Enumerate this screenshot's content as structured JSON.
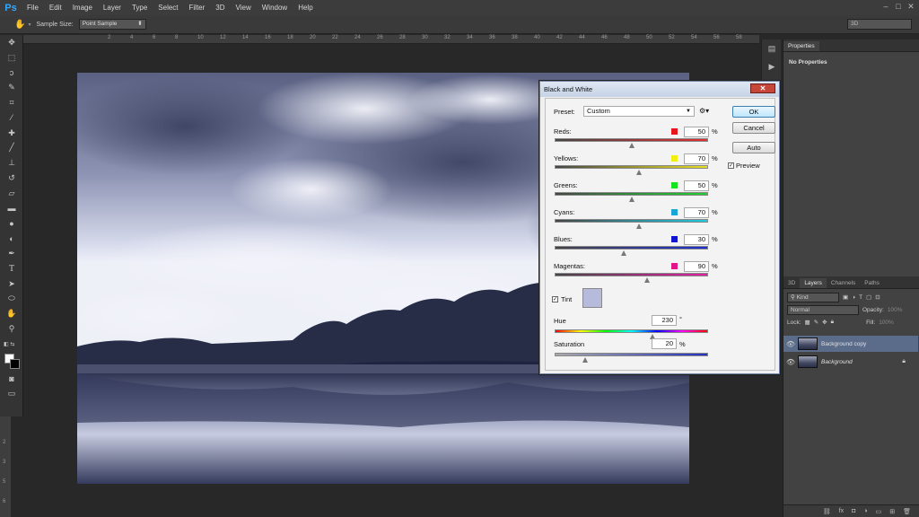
{
  "app": {
    "logo": "Ps",
    "menu": [
      "File",
      "Edit",
      "Image",
      "Layer",
      "Type",
      "Select",
      "Filter",
      "3D",
      "View",
      "Window",
      "Help"
    ]
  },
  "options_bar": {
    "sample_size_label": "Sample Size:",
    "sample_size_value": "Point Sample",
    "workspace": "3D"
  },
  "ruler": {
    "h_ticks": [
      "2",
      "4",
      "6",
      "8",
      "10",
      "12",
      "14",
      "16",
      "18",
      "20",
      "22",
      "24",
      "26",
      "28",
      "30",
      "32",
      "34",
      "36",
      "38",
      "40",
      "42",
      "44",
      "46",
      "48",
      "50",
      "52",
      "54",
      "56",
      "58"
    ],
    "v_ticks": [
      "2",
      "3",
      "5",
      "6"
    ]
  },
  "properties_panel": {
    "tab": "Properties",
    "message": "No Properties"
  },
  "layers_panel": {
    "tabs": [
      "3D",
      "Layers",
      "Channels",
      "Paths"
    ],
    "active_tab": "Layers",
    "filter": "Kind",
    "blend_mode": "Normal",
    "opacity_label": "Opacity:",
    "opacity_value": "100%",
    "lock_label": "Lock:",
    "fill_label": "Fill:",
    "fill_value": "100%",
    "layers": [
      {
        "name": "Background copy",
        "selected": true
      },
      {
        "name": "Background",
        "selected": false,
        "locked": true
      }
    ]
  },
  "dialog": {
    "title": "Black and White",
    "preset_label": "Preset:",
    "preset_value": "Custom",
    "buttons": {
      "ok": "OK",
      "cancel": "Cancel",
      "auto": "Auto"
    },
    "preview_label": "Preview",
    "preview_checked": true,
    "channels": [
      {
        "label": "Reds:",
        "value": "50",
        "unit": "%",
        "color": "#e8161c",
        "fraction": 0.5
      },
      {
        "label": "Yellows:",
        "value": "70",
        "unit": "%",
        "color": "#f1f011",
        "fraction": 0.55
      },
      {
        "label": "Greens:",
        "value": "50",
        "unit": "%",
        "color": "#13e41b",
        "fraction": 0.5
      },
      {
        "label": "Cyans:",
        "value": "70",
        "unit": "%",
        "color": "#18a6d7",
        "fraction": 0.55
      },
      {
        "label": "Blues:",
        "value": "30",
        "unit": "%",
        "color": "#1413d1",
        "fraction": 0.45
      },
      {
        "label": "Magentas:",
        "value": "90",
        "unit": "%",
        "color": "#e2168a",
        "fraction": 0.6
      }
    ],
    "tint_label": "Tint",
    "tint_checked": true,
    "tint_color": "#b6bbdb",
    "hue_label": "Hue",
    "hue_value": "230",
    "hue_unit": "°",
    "hue_fraction": 0.64,
    "saturation_label": "Saturation",
    "saturation_value": "20",
    "saturation_unit": "%",
    "saturation_fraction": 0.2
  }
}
